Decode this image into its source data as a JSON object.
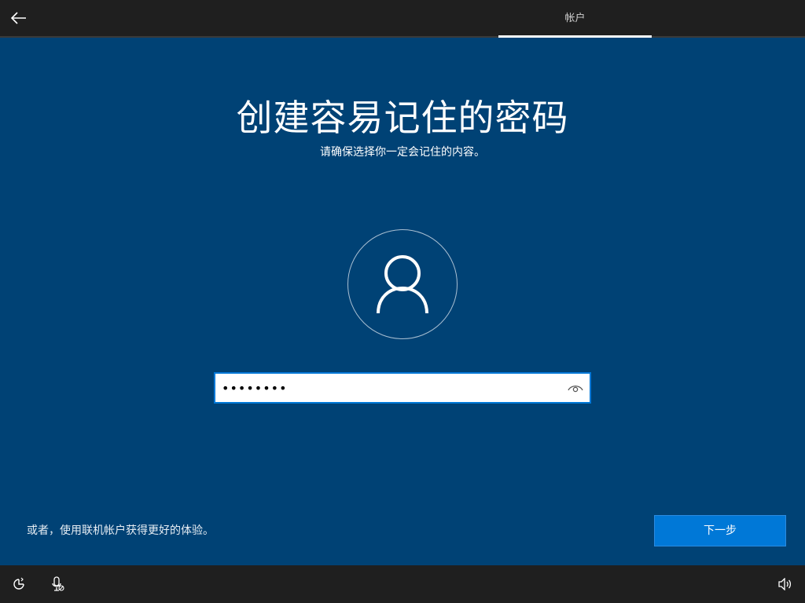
{
  "topbar": {
    "back_icon": "back-arrow-icon",
    "tab_label": "帐户"
  },
  "main": {
    "title": "创建容易记住的密码",
    "subtitle": "请确保选择你一定会记住的内容。",
    "avatar_icon": "user-icon",
    "password": {
      "value": "••••••••",
      "reveal_icon": "eye-icon"
    }
  },
  "footer": {
    "offline_link": "或者，使用联机帐户获得更好的体验。",
    "next_label": "下一步"
  },
  "bottombar": {
    "left_icons": [
      "ease-of-access-icon",
      "microphone-icon"
    ],
    "right_icon": "volume-icon"
  },
  "colors": {
    "background": "#004275",
    "bar": "#1f1f1f",
    "accent": "#0078d7"
  }
}
